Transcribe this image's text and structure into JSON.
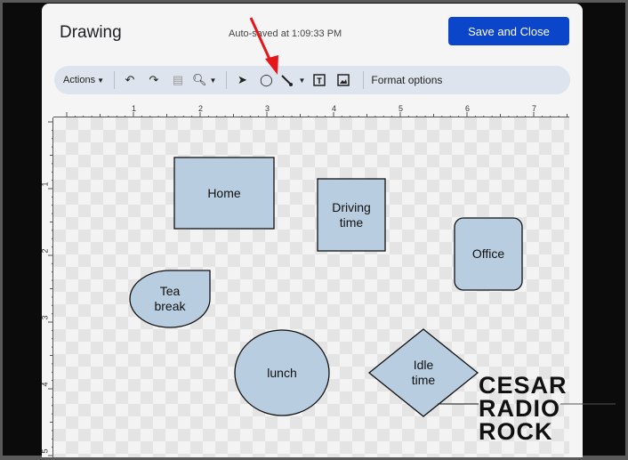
{
  "dialog": {
    "title": "Drawing",
    "autosave": "Auto-saved at 1:09:33 PM",
    "save_label": "Save and Close"
  },
  "toolbar": {
    "actions_label": "Actions",
    "format_options": "Format options"
  },
  "ruler": {
    "horizontal": [
      "1",
      "2",
      "3",
      "4",
      "5",
      "6",
      "7"
    ],
    "vertical": [
      "1",
      "2",
      "3",
      "4",
      "5"
    ]
  },
  "shapes": [
    {
      "type": "rectangle",
      "label": "Home"
    },
    {
      "type": "rectangle",
      "label_lines": [
        "Driving",
        "time"
      ]
    },
    {
      "type": "rounded-rectangle",
      "label": "Office"
    },
    {
      "type": "teardrop",
      "label_lines": [
        "Tea",
        "break"
      ]
    },
    {
      "type": "ellipse",
      "label": "lunch"
    },
    {
      "type": "diamond",
      "label_lines": [
        "Idle",
        "time"
      ]
    }
  ],
  "colors": {
    "shape_fill": "#b9cde0",
    "save_button": "#0b45c9",
    "annotation_arrow": "#e3161b"
  },
  "watermark": {
    "lines": [
      "CESAR",
      "RADIO",
      "ROCK"
    ]
  }
}
